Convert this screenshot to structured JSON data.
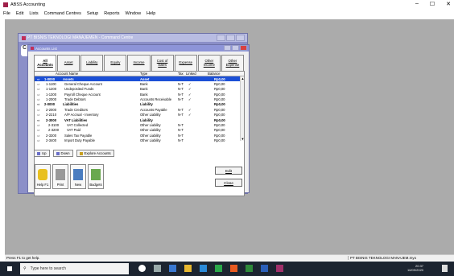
{
  "window": {
    "app_title": "ABSS Accounting",
    "controls": [
      "–",
      "☐",
      "✕"
    ]
  },
  "menu": [
    "File",
    "Edit",
    "Lists",
    "Command Centres",
    "Setup",
    "Reports",
    "Window",
    "Help"
  ],
  "command_centre": {
    "title": "PT BISNIS TEKNOLOGI MANAJEMEN - Command Centre",
    "strip_letter": "C"
  },
  "accounts_list": {
    "title": "Accounts List",
    "tabs": [
      {
        "label": "All\nAccounts",
        "active": true
      },
      {
        "label": "Asset"
      },
      {
        "label": "Liability"
      },
      {
        "label": "Equity"
      },
      {
        "label": "Income"
      },
      {
        "label": "Cost of\nSales"
      },
      {
        "label": "Expense"
      },
      {
        "label": "Other\nIncome"
      },
      {
        "label": "Other\nExpense"
      }
    ],
    "columns": {
      "name": "Account Name",
      "type": "Type",
      "tax": "Tax",
      "linked": "Linked",
      "balance": "Balance"
    },
    "rows": [
      {
        "exp": "⇨",
        "code": "1-0000",
        "name": "Assets",
        "type": "Asset",
        "tax": "",
        "linked": "",
        "balance": "Rp0,00",
        "bold": true,
        "selected": true,
        "indent": 0
      },
      {
        "exp": "⇨",
        "code": "1-1100",
        "name": "General Cheque Account",
        "type": "Bank",
        "tax": "N-T",
        "linked": "✓",
        "balance": "Rp0,00",
        "indent": 1
      },
      {
        "exp": "⇨",
        "code": "1-1200",
        "name": "Undeposited Funds",
        "type": "Bank",
        "tax": "N-T",
        "linked": "✓",
        "balance": "Rp0,00",
        "indent": 1
      },
      {
        "exp": "⇨",
        "code": "1-1300",
        "name": "Payroll Cheque Account",
        "type": "Bank",
        "tax": "N-T",
        "linked": "✓",
        "balance": "Rp0,00",
        "indent": 1
      },
      {
        "exp": "⇨",
        "code": "1-2000",
        "name": "Trade Debtors",
        "type": "Accounts Receivable",
        "tax": "N-T",
        "linked": "✓",
        "balance": "Rp0,00",
        "indent": 1
      },
      {
        "exp": "⇨",
        "code": "2-0000",
        "name": "Liabilities",
        "type": "Liability",
        "tax": "",
        "linked": "",
        "balance": "Rp0,00",
        "bold": true,
        "indent": 0
      },
      {
        "exp": "⇨",
        "code": "2-2000",
        "name": "Trade Creditors",
        "type": "Accounts Payable",
        "tax": "N-T",
        "linked": "✓",
        "balance": "Rp0,00",
        "indent": 1
      },
      {
        "exp": "⇨",
        "code": "2-2210",
        "name": "A/P Accrual - Inventory",
        "type": "Other Liability",
        "tax": "N-T",
        "linked": "✓",
        "balance": "Rp0,00",
        "indent": 1
      },
      {
        "exp": "⇨",
        "code": "2-3000",
        "name": "VAT Liabilities",
        "type": "Liability",
        "tax": "",
        "linked": "",
        "balance": "Rp0,00",
        "bold": true,
        "indent": 1
      },
      {
        "exp": "⇨",
        "code": "2-3100",
        "name": "VAT Collected",
        "type": "Other Liability",
        "tax": "N-T",
        "linked": "",
        "balance": "Rp0,00",
        "indent": 2
      },
      {
        "exp": "⇨",
        "code": "2-3200",
        "name": "VAT Paid",
        "type": "Other Liability",
        "tax": "N-T",
        "linked": "",
        "balance": "Rp0,00",
        "indent": 2
      },
      {
        "exp": "⇨",
        "code": "2-3300",
        "name": "Sales Tax Payable",
        "type": "Other Liability",
        "tax": "N-T",
        "linked": "",
        "balance": "Rp0,00",
        "indent": 1
      },
      {
        "exp": "⇨",
        "code": "2-3400",
        "name": "Import Duty Payable",
        "type": "Other Liability",
        "tax": "N-T",
        "linked": "",
        "balance": "Rp0,00",
        "indent": 1
      }
    ],
    "buttons": {
      "up": "Up",
      "down": "Down",
      "explore": "Explore Accounts",
      "help": "Help F1",
      "print": "Print",
      "new": "New",
      "budgets": "Budgets",
      "edit": "Edit",
      "close": "Close"
    }
  },
  "status": {
    "left": "Press F1 to get help.",
    "right": "PT BISNIS TEKNOLOGI MANAJEM.myo"
  },
  "taskbar": {
    "search_placeholder": "Type here to search",
    "time": "20:37",
    "date": "16/09/2020",
    "tray_lang": "^ ■ ⋄"
  }
}
